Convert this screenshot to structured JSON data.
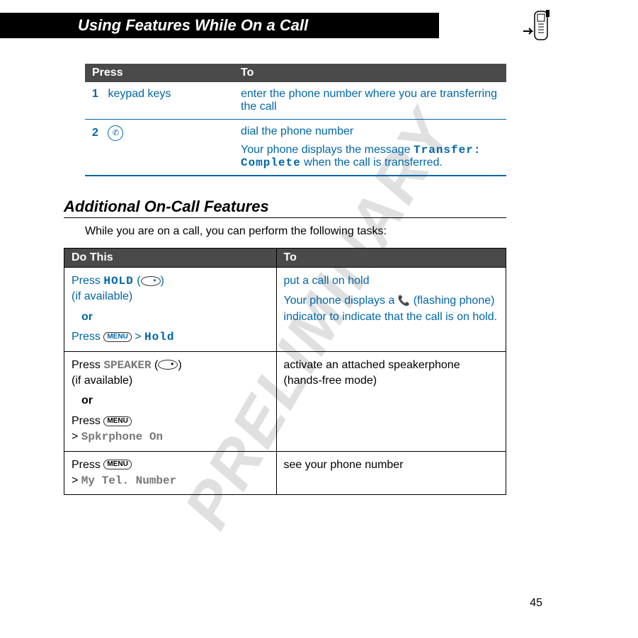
{
  "header": {
    "title": "Using Features While On a Call"
  },
  "watermark": "PRELIMINARY",
  "table1": {
    "headers": {
      "col1": "Press",
      "col2": "To"
    },
    "rows": [
      {
        "step": "1",
        "press": "keypad keys",
        "to": "enter the phone number where you are transferring the call"
      },
      {
        "step": "2",
        "press_icon": "send-key",
        "to_line1": "dial the phone number",
        "to_line2a": "Your phone displays the message ",
        "to_mono": "Transfer: Complete",
        "to_line2b": " when the call is transferred."
      }
    ]
  },
  "section": {
    "heading": "Additional On-Call Features",
    "intro": "While you are on a call, you can perform the following tasks:"
  },
  "table2": {
    "headers": {
      "col1": "Do This",
      "col2": "To"
    },
    "rows": [
      {
        "do_prefix": "Press ",
        "do_mono1": "HOLD",
        "do_paren": " (",
        "do_paren_close": ")",
        "do_avail": "(if available)",
        "or": "or",
        "do2_prefix": "Press ",
        "do2_gt": " > ",
        "do2_mono": "Hold",
        "to1": "put a call on hold",
        "to2a": "Your phone displays a ",
        "to2b": " (flashing phone) indicator to indicate that the call is on hold.",
        "blue": true
      },
      {
        "do_prefix": "Press ",
        "do_mono1": "SPEAKER",
        "do_paren": " (",
        "do_paren_close": ")",
        "do_avail": "(if available)",
        "or": "or",
        "do2_prefix": "Press ",
        "do2_gt": "> ",
        "do2_mono": "Spkrphone On",
        "to1": "activate an attached speakerphone",
        "to2": "(hands-free mode)"
      },
      {
        "do_prefix": "Press ",
        "do2_gt": "> ",
        "do2_mono": "My Tel. Number",
        "to1": "see your phone number"
      }
    ]
  },
  "page": "45"
}
